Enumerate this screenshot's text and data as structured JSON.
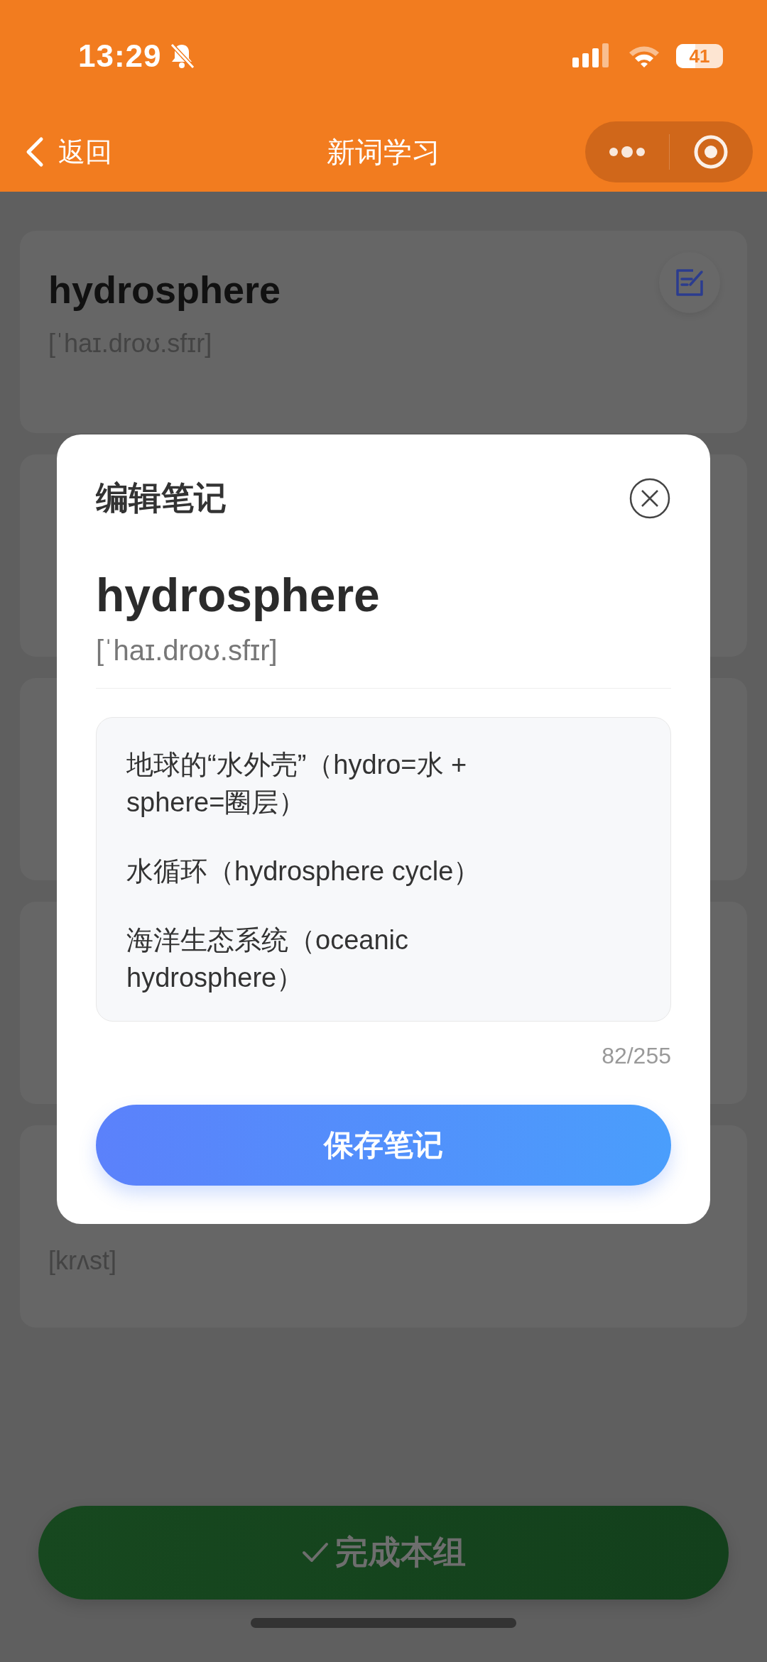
{
  "status_bar": {
    "time": "13:29",
    "battery": "41"
  },
  "nav": {
    "back": "返回",
    "title": "新词学习"
  },
  "word_cards": [
    {
      "kind": "full",
      "word": "hydrosphere",
      "phonetic": "[ˈhaɪ.droʊ.sfɪr]"
    },
    {
      "kind": "hidden"
    },
    {
      "kind": "hidden"
    },
    {
      "kind": "hidden"
    },
    {
      "kind": "phonetic",
      "phonetic": "[krʌst]"
    }
  ],
  "modal": {
    "title": "编辑笔记",
    "word": "hydrosphere",
    "phonetic": "[ˈhaɪ.droʊ.sfɪr]",
    "note_paragraphs": [
      "地球的“水外壳”（hydro=水 + sphere=圈层）",
      "水循环（hydrosphere cycle）",
      "海洋生态系统（oceanic hydrosphere）"
    ],
    "counter": "82/255",
    "save": "保存笔记"
  },
  "footer_button": "完成本组"
}
